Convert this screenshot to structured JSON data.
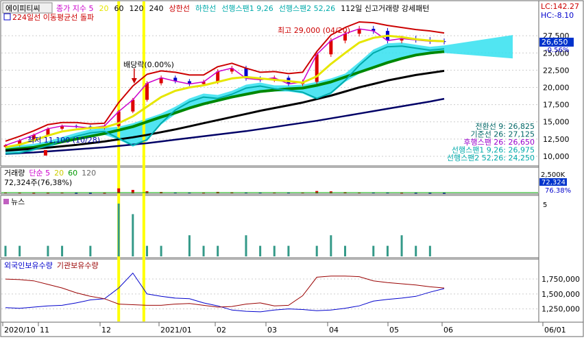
{
  "header": {
    "stock_name": "에이피티씨",
    "legend_price": [
      {
        "label": "종가 지수 5",
        "color": "#cc00cc"
      },
      {
        "label": "20",
        "color": "#e6e600"
      },
      {
        "label": "60",
        "color": "#000000"
      },
      {
        "label": "120",
        "color": "#000000"
      },
      {
        "label": "240",
        "color": "#000000"
      },
      {
        "label": "상한선",
        "color": "#cc0000"
      },
      {
        "label": "하한선",
        "color": "#00aaaa"
      },
      {
        "label": "선행스팬1 9,26",
        "color": "#00aaaa"
      },
      {
        "label": "선행스팬2 52,26",
        "color": "#00aaaa"
      },
      {
        "label": "112일 신고거래량 강세패턴",
        "color": "#000000"
      }
    ],
    "signal_text": "224일선 이동평균선 돌파",
    "lc_text": "LC:142.27",
    "hc_text": "HC:-8.10"
  },
  "annotations": {
    "high": "최고 29,000 (04/20)",
    "low": "최저 11,100 (10/28)",
    "dividend": "배당락(0.00%)"
  },
  "price_axis": {
    "ticks": [
      "27,500",
      "25,000",
      "22,500",
      "20,000",
      "17,500",
      "15,000",
      "12,500",
      "10,000"
    ],
    "current_price": "26,650",
    "current_change": "-0.56%"
  },
  "ichimoku_values": [
    {
      "text": "전환선 9: 26,825",
      "color": "#006666"
    },
    {
      "text": "기준선 26: 27,125",
      "color": "#006666"
    },
    {
      "text": "후행스팬 26: 26,650",
      "color": "#9900cc"
    },
    {
      "text": "선행스팬1 9,26: 26,975",
      "color": "#00aaaa"
    },
    {
      "text": "선행스팬2 52,26: 24,250",
      "color": "#00aaaa"
    }
  ],
  "volume_panel": {
    "legend": [
      {
        "label": "거래량",
        "color": "#000000"
      },
      {
        "label": "단순 5",
        "color": "#cc00cc"
      },
      {
        "label": "20",
        "color": "#cccc00"
      },
      {
        "label": "60",
        "color": "#009900"
      },
      {
        "label": "120",
        "color": "#666666"
      }
    ],
    "value_text": "72,324주(76,38%)",
    "axis_top": "2,500K",
    "current": "72,324",
    "pct": "76.38%"
  },
  "news_panel": {
    "title": "뉴스",
    "axis_top": "5"
  },
  "holdings_panel": {
    "legend": [
      {
        "label": "외국인보유수량",
        "color": "#0000cc"
      },
      {
        "label": "기관보유수량",
        "color": "#990000"
      }
    ],
    "ticks": [
      "1,750,000",
      "1,500,000",
      "1,250,000"
    ]
  },
  "date_axis": {
    "labels": [
      "2020/10",
      "11",
      "12",
      "2021/01",
      "02",
      "03",
      "04",
      "05",
      "06",
      "06/01"
    ]
  },
  "chart_data": {
    "type": "line",
    "title": "에이피티씨",
    "x": [
      "2020-10-26",
      "2020-11-02",
      "2020-11-09",
      "2020-11-16",
      "2020-11-23",
      "2020-11-30",
      "2020-12-07",
      "2020-12-14",
      "2020-12-21",
      "2020-12-28",
      "2021-01-04",
      "2021-01-11",
      "2021-01-18",
      "2021-01-25",
      "2021-02-01",
      "2021-02-08",
      "2021-02-15",
      "2021-02-22",
      "2021-03-01",
      "2021-03-08",
      "2021-03-15",
      "2021-03-22",
      "2021-03-29",
      "2021-04-05",
      "2021-04-12",
      "2021-04-19",
      "2021-04-26",
      "2021-05-03",
      "2021-05-10",
      "2021-05-17",
      "2021-05-24",
      "2021-05-31"
    ],
    "series": [
      {
        "name": "종가 지수 5",
        "color": "#cc00cc",
        "values": [
          11600,
          12300,
          13100,
          14000,
          14400,
          14300,
          14100,
          14400,
          16500,
          18200,
          20600,
          21400,
          20900,
          20500,
          20800,
          22300,
          22800,
          21300,
          21100,
          21400,
          20500,
          20800,
          24800,
          26800,
          27800,
          28500,
          28200,
          26800,
          27100,
          26900,
          26700,
          26650
        ]
      },
      {
        "name": "20",
        "color": "#e6e600",
        "values": [
          11300,
          11700,
          12300,
          13000,
          13600,
          13900,
          14100,
          14200,
          14800,
          15800,
          17200,
          18600,
          19500,
          20000,
          20300,
          20800,
          21300,
          21500,
          21300,
          21100,
          20900,
          20700,
          21600,
          23400,
          25000,
          26500,
          27200,
          27500,
          27300,
          27000,
          26800,
          26700
        ]
      },
      {
        "name": "60",
        "color": "#008800",
        "values": [
          10900,
          11100,
          11300,
          11700,
          12100,
          12500,
          12900,
          13300,
          13800,
          14300,
          15000,
          15700,
          16300,
          17000,
          17600,
          18100,
          18600,
          19000,
          19400,
          19600,
          19800,
          19900,
          20300,
          20800,
          21500,
          22200,
          22900,
          23600,
          24200,
          24700,
          25000,
          25200
        ]
      },
      {
        "name": "120",
        "color": "#000000",
        "values": [
          10800,
          10950,
          11100,
          11250,
          11450,
          11650,
          11900,
          12150,
          12450,
          12750,
          13100,
          13500,
          13900,
          14350,
          14800,
          15250,
          15700,
          16150,
          16600,
          17000,
          17400,
          17800,
          18300,
          18800,
          19400,
          20000,
          20500,
          21000,
          21400,
          21800,
          22100,
          22400
        ]
      },
      {
        "name": "240",
        "color": "#000066",
        "values": [
          10350,
          10450,
          10550,
          10700,
          10850,
          11000,
          11150,
          11300,
          11500,
          11700,
          11900,
          12150,
          12400,
          12650,
          12900,
          13150,
          13400,
          13650,
          13950,
          14250,
          14550,
          14850,
          15150,
          15500,
          15850,
          16200,
          16550,
          16900,
          17250,
          17600,
          17950,
          18350
        ]
      },
      {
        "name": "상한선",
        "color": "#cc0000",
        "values": [
          12200,
          12900,
          13700,
          14600,
          14900,
          14900,
          14700,
          14800,
          17800,
          20200,
          21900,
          22400,
          22200,
          21800,
          21800,
          23000,
          23500,
          22800,
          22200,
          22300,
          22000,
          22200,
          25200,
          27600,
          28700,
          29500,
          29400,
          29000,
          28700,
          28400,
          28200,
          27900
        ]
      },
      {
        "name": "하한선",
        "color": "#00aaaa",
        "values": [
          10400,
          10500,
          11000,
          11500,
          12300,
          12900,
          13400,
          13600,
          12600,
          11600,
          12400,
          14800,
          16700,
          17900,
          18600,
          18400,
          19000,
          19900,
          20200,
          19800,
          19600,
          19300,
          18400,
          19200,
          21000,
          23200,
          25000,
          25900,
          26000,
          25700,
          25400,
          25600
        ]
      }
    ],
    "ylim": [
      9000,
      30500
    ],
    "high": {
      "date": "2021-04-20",
      "value": 29000
    },
    "low": {
      "date": "2020-10-28",
      "value": 11100
    },
    "dividend_marker_date": "2020-12-28",
    "volume": {
      "ylim": [
        0,
        2500
      ],
      "values": [
        140,
        110,
        90,
        100,
        120,
        80,
        70,
        90,
        900,
        620,
        380,
        250,
        150,
        120,
        110,
        260,
        210,
        140,
        120,
        160,
        120,
        150,
        420,
        360,
        220,
        180,
        140,
        120,
        100,
        90,
        80,
        72
      ]
    },
    "news": {
      "ylim": [
        0,
        5
      ],
      "values": [
        1,
        1,
        0,
        1,
        1,
        0,
        1,
        0,
        5,
        4,
        1,
        1,
        0,
        2,
        1,
        1,
        0,
        2,
        1,
        1,
        1,
        0,
        1,
        2,
        1,
        0,
        1,
        1,
        2,
        1,
        1,
        0
      ]
    },
    "holdings": {
      "ylim": [
        1050000,
        1900000
      ],
      "series": [
        {
          "name": "외국인보유수량",
          "color": "#0000cc",
          "values": [
            1270000,
            1260000,
            1280000,
            1300000,
            1310000,
            1350000,
            1400000,
            1420000,
            1600000,
            1850000,
            1500000,
            1460000,
            1430000,
            1420000,
            1350000,
            1300000,
            1230000,
            1210000,
            1200000,
            1230000,
            1250000,
            1240000,
            1220000,
            1230000,
            1260000,
            1300000,
            1380000,
            1410000,
            1430000,
            1460000,
            1530000,
            1590000
          ]
        },
        {
          "name": "기관보유수량",
          "color": "#990000",
          "values": [
            1750000,
            1740000,
            1720000,
            1660000,
            1600000,
            1520000,
            1460000,
            1420000,
            1330000,
            1320000,
            1310000,
            1310000,
            1330000,
            1340000,
            1310000,
            1280000,
            1290000,
            1330000,
            1350000,
            1300000,
            1310000,
            1470000,
            1780000,
            1800000,
            1800000,
            1790000,
            1720000,
            1690000,
            1670000,
            1650000,
            1620000,
            1600000
          ]
        }
      ]
    }
  }
}
